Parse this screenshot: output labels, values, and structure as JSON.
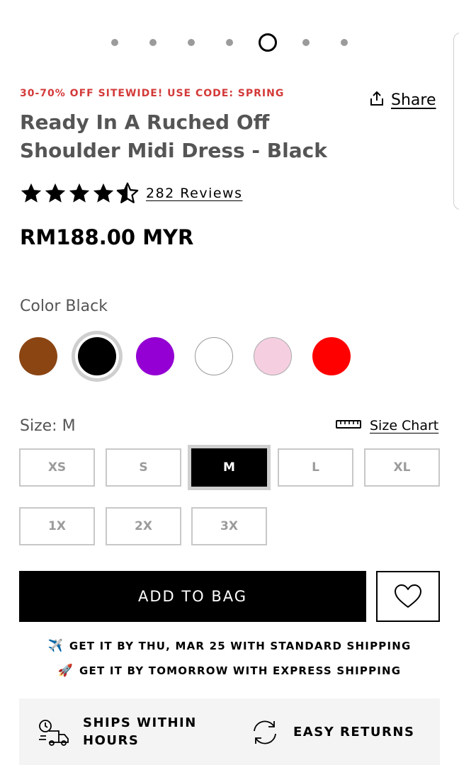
{
  "carousel": {
    "dot_count": 7,
    "active_index": 4
  },
  "promo_text": "30-70% OFF SITEWIDE! USE CODE: SPRING",
  "share_label": "Share",
  "product": {
    "title": "Ready In A Ruched Off Shoulder Midi Dress - Black",
    "rating": 4.5,
    "reviews_label": "282 Reviews",
    "price": "RM188.00 MYR"
  },
  "color": {
    "label": "Color Black",
    "swatches": [
      {
        "name": "brown",
        "hex": "#8b4513",
        "selected": false
      },
      {
        "name": "black",
        "hex": "#000000",
        "selected": true
      },
      {
        "name": "purple",
        "hex": "#9400d3",
        "selected": false
      },
      {
        "name": "white",
        "hex": "#ffffff",
        "selected": false
      },
      {
        "name": "pink",
        "hex": "#f5cfe0",
        "selected": false
      },
      {
        "name": "red",
        "hex": "#ff0000",
        "selected": false
      }
    ]
  },
  "size": {
    "label": "Size: M",
    "chart_label": "Size Chart",
    "options": [
      "XS",
      "S",
      "M",
      "L",
      "XL",
      "1X",
      "2X",
      "3X"
    ],
    "selected": "M"
  },
  "actions": {
    "add_to_bag": "ADD TO BAG"
  },
  "shipping": {
    "standard_emoji": "✈️",
    "standard": "GET IT BY THU, MAR 25 WITH STANDARD SHIPPING",
    "express_emoji": "🚀",
    "express": "GET IT BY TOMORROW WITH EXPRESS SHIPPING"
  },
  "perks": {
    "ships_line1": "SHIPS WITHIN",
    "ships_line2": "HOURS",
    "returns": "EASY RETURNS"
  },
  "colors": {
    "promo": "#d43a3a",
    "accent": "#000000",
    "muted_text": "#555555"
  }
}
